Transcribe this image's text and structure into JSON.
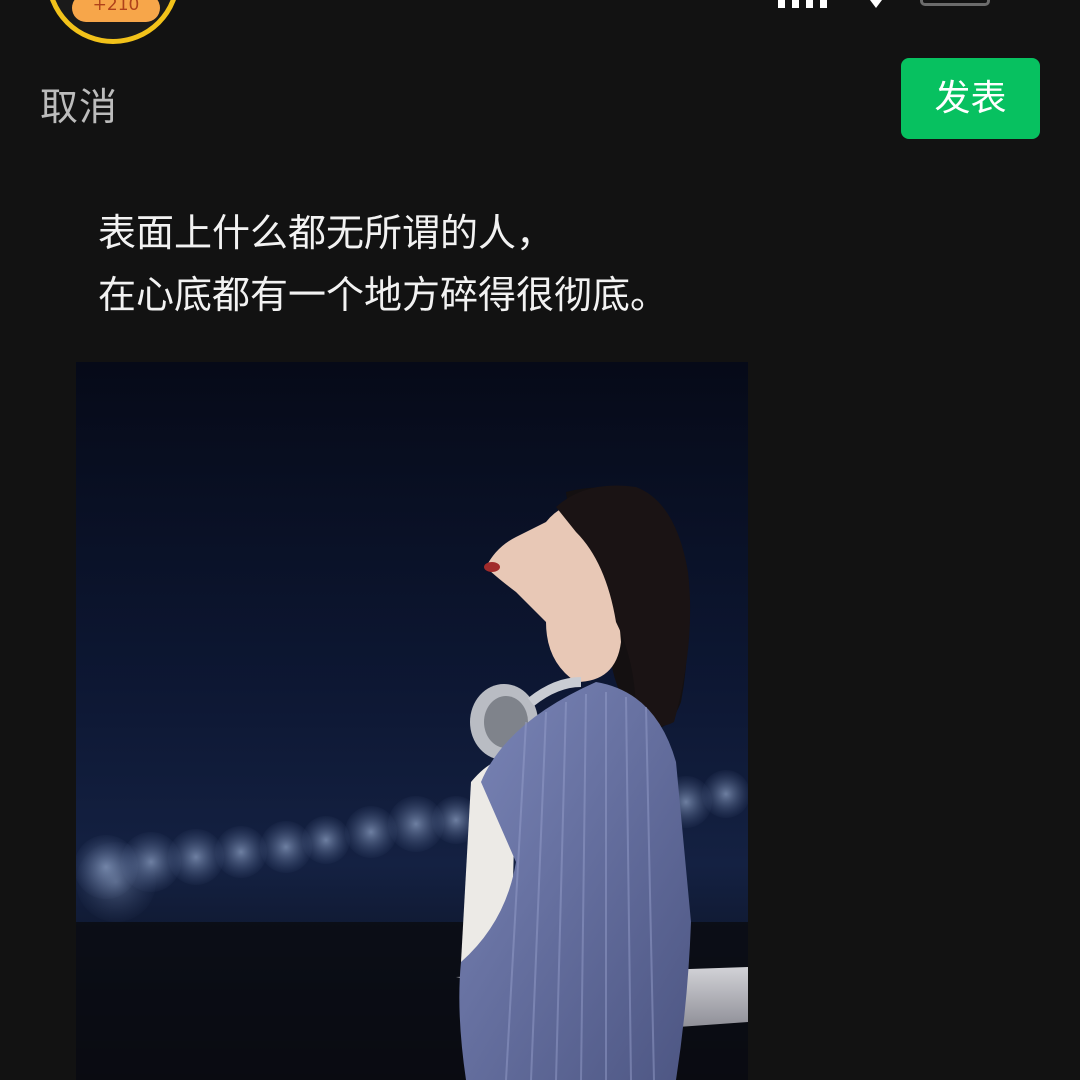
{
  "status_bar": {
    "points_badge": "+210",
    "signal_icon": "signal-bars-icon",
    "wifi_icon": "wifi-icon",
    "battery_icon": "battery-icon"
  },
  "header": {
    "cancel_label": "取消",
    "publish_label": "发表"
  },
  "post": {
    "lines": [
      "表面上什么都无所谓的人，",
      "在心底都有一个地方碎得很彻底。"
    ]
  },
  "colors": {
    "background": "#121212",
    "accent_green": "#07c160",
    "badge_ring": "#f2c21a",
    "badge_fill": "#f7a64a"
  }
}
